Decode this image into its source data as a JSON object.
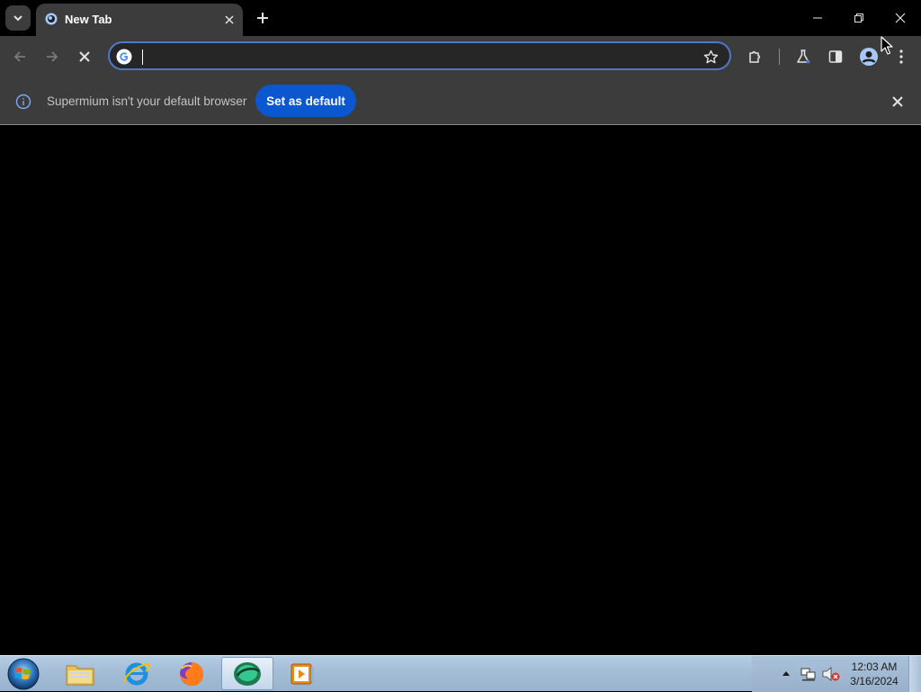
{
  "window": {
    "tab_title": "New Tab",
    "controls": [
      "minimize",
      "restore",
      "close"
    ]
  },
  "toolbar": {
    "omnibox_value": "",
    "search_engine_icon": "google-g-icon",
    "icons": [
      "back-arrow-icon",
      "forward-arrow-icon",
      "stop-loading-icon",
      "bookmark-star-icon",
      "extensions-puzzle-icon",
      "labs-flask-icon",
      "side-panel-icon",
      "profile-avatar-icon",
      "menu-dots-icon"
    ]
  },
  "infobar": {
    "message": "Supermium isn't your default browser",
    "button_label": "Set as default"
  },
  "taskbar": {
    "apps": [
      "file-explorer",
      "internet-explorer",
      "firefox",
      "supermium",
      "media-player"
    ],
    "active_app": "supermium",
    "clock_time": "12:03 AM",
    "clock_date": "3/16/2024"
  },
  "colors": {
    "accent": "#0b57d0",
    "frame": "#3c3c3c",
    "omnibox_focus_ring": "#4d78c8",
    "content_bg": "#000000"
  }
}
